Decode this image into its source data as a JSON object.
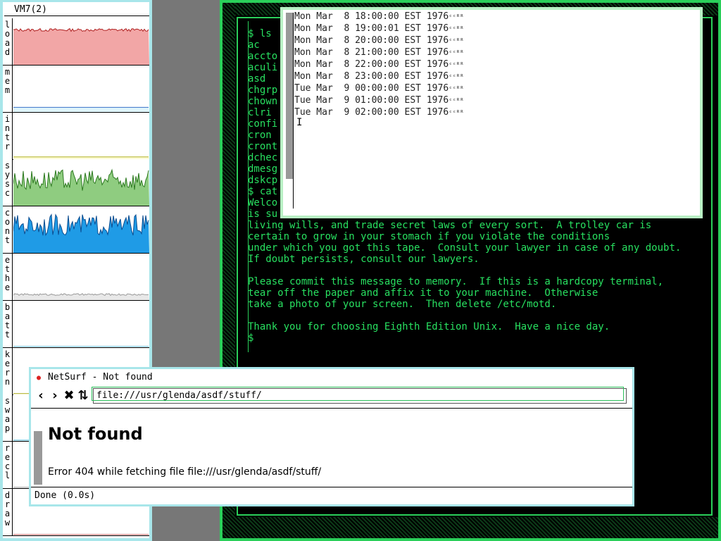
{
  "stats": {
    "title": "VM7(2)",
    "rows": [
      {
        "label": "load",
        "color": "#f2a6a6",
        "line": "#b02020",
        "level": 0.75
      },
      {
        "label": "mem",
        "color": "#dff5fb",
        "line": "#3a70c8",
        "level": 0.1
      },
      {
        "label": "intr",
        "color": "#fdfbd8",
        "line": "#b0b020",
        "level": 0.05
      },
      {
        "label": "sysc",
        "color": "#8fcc80",
        "line": "#2d7a20",
        "level": 0.55
      },
      {
        "label": "cont",
        "color": "#1f9be6",
        "line": "#0a4c90",
        "level": 0.6
      },
      {
        "label": "ethe",
        "color": "#e8e8e8",
        "line": "#999999",
        "level": 0.1
      },
      {
        "label": "batt",
        "color": "#e8fafd",
        "line": "#7ac8e0",
        "level": 0.0
      },
      {
        "label": "kern",
        "color": "#fdfbe0",
        "line": "#b0b030",
        "level": 0.0
      },
      {
        "label": "swap",
        "color": "#cfeffa",
        "line": "#7ac8e0",
        "level": 0.0
      },
      {
        "label": "recl",
        "color": "#eeeeee",
        "line": "#aaaaaa",
        "level": 0.0
      },
      {
        "label": "draw",
        "color": "#fde3e3",
        "line": "#d08080",
        "level": 0.0
      }
    ]
  },
  "terminal": {
    "lines": [
      "$ ls",
      "ac",
      "accto",
      "aculi",
      "asd",
      "chgrp",
      "chown",
      "clri",
      "confi",
      "cron",
      "cront",
      "dchec",
      "dmesg",
      "dskcp",
      "$ cat",
      "Welco",
      "is su",
      "living wills, and trade secret laws of every sort.  A trolley car is",
      "certain to grow in your stomach if you violate the conditions",
      "under which you got this tape.  Consult your lawyer in case of any doubt.",
      "If doubt persists, consult our lawyers.",
      "",
      "Please commit this message to memory.  If this is a hardcopy terminal,",
      "tear off the paper and affix it to your machine.  Otherwise",
      "take a photo of your screen.  Then delete /etc/motd.",
      "",
      "Thank you for choosing Eighth Edition Unix.  Have a nice day.",
      "$"
    ]
  },
  "clock": {
    "lines": [
      "Mon Mar  8 18:00:00 EST 1976",
      "Mon Mar  8 19:00:01 EST 1976",
      "Mon Mar  8 20:00:00 EST 1976",
      "Mon Mar  8 21:00:00 EST 1976",
      "Mon Mar  8 22:00:00 EST 1976",
      "Mon Mar  8 23:00:00 EST 1976",
      "Tue Mar  9 00:00:00 EST 1976",
      "Tue Mar  9 01:00:00 EST 1976",
      "Tue Mar  9 02:00:00 EST 1976"
    ],
    "suffix": "ᶜᶜᴿᴿ"
  },
  "netsurf": {
    "title": "NetSurf - Not found",
    "url": "file:///usr/glenda/asdf/stuff/",
    "heading": "Not found",
    "error": "Error 404 while fetching file file:///usr/glenda/asdf/stuff/",
    "status": "Done (0.0s)",
    "nav_icons": [
      "back-icon",
      "forward-icon",
      "stop-icon",
      "reload-icon"
    ]
  }
}
